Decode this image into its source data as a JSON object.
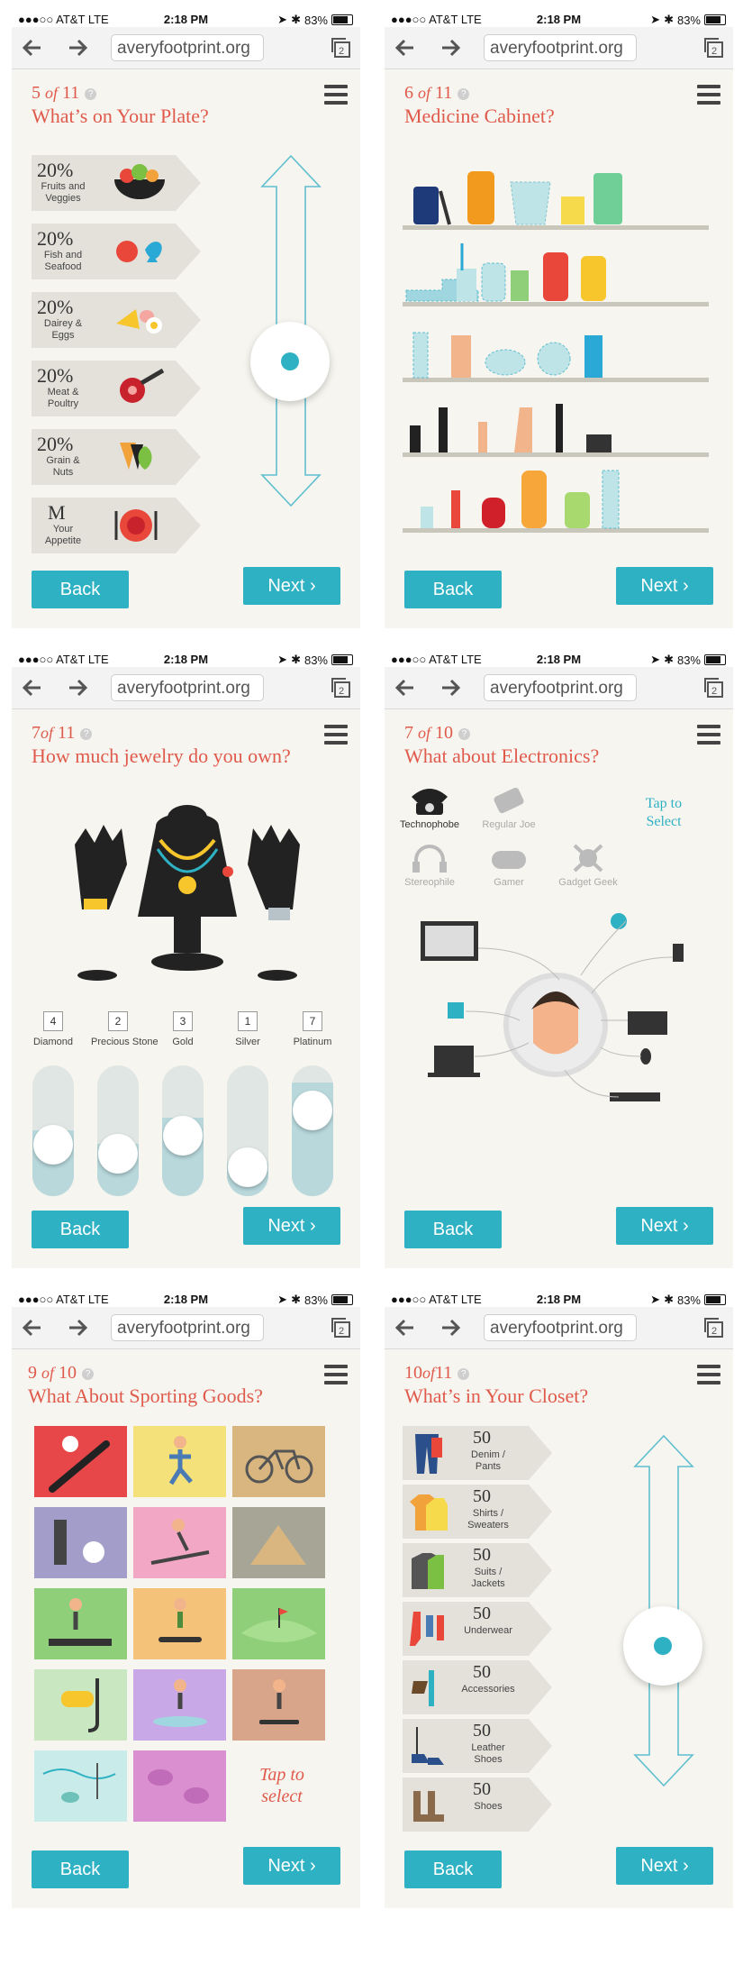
{
  "status": {
    "carrier": "●●●○○ AT&T",
    "network": "LTE",
    "time": "2:18 PM",
    "battery": "83%"
  },
  "url": "averyfootprint.org",
  "buttons": {
    "back": "Back",
    "next": "Next"
  },
  "help": "?",
  "screens": {
    "plate": {
      "step_num": "5",
      "step_of": "of",
      "step_total": "11",
      "question": "What’s on Your Plate?",
      "items": [
        {
          "value": "20%",
          "label": "Fruits and Veggies"
        },
        {
          "value": "20%",
          "label": "Fish and Seafood"
        },
        {
          "value": "20%",
          "label": "Dairey & Eggs"
        },
        {
          "value": "20%",
          "label": "Meat & Poultry"
        },
        {
          "value": "20%",
          "label": "Grain & Nuts"
        },
        {
          "value": "M",
          "label": "Your Appetite"
        }
      ]
    },
    "medicine": {
      "step_num": "6",
      "step_of": "of",
      "step_total": "11",
      "question": "Medicine Cabinet?"
    },
    "jewelry": {
      "step_num": "7",
      "step_of": "of",
      "step_total": "11",
      "question": "How much jewelry do you own?",
      "sliders": [
        {
          "value": "4",
          "label": "Diamond",
          "level": 0.35
        },
        {
          "value": "2",
          "label": "Precious Stone",
          "level": 0.25
        },
        {
          "value": "3",
          "label": "Gold",
          "level": 0.45
        },
        {
          "value": "1",
          "label": "Silver",
          "level": 0.1
        },
        {
          "value": "7",
          "label": "Platinum",
          "level": 0.72
        }
      ]
    },
    "electronics": {
      "step_num": "7",
      "step_of": "of",
      "step_total": "10",
      "question": "What about Electronics?",
      "types": [
        "Technophobe",
        "Regular Joe",
        "Stereophile",
        "Gamer",
        "Gadget Geek"
      ],
      "tap_hint": "Tap to Select"
    },
    "sporting": {
      "step_num": "9",
      "step_of": "of",
      "step_total": "10",
      "question": "What About Sporting Goods?",
      "tap_hint": "Tap to select"
    },
    "closet": {
      "step_num": "10",
      "step_of": "of",
      "step_total": "11",
      "question": "What’s in Your Closet?",
      "items": [
        {
          "value": "50",
          "label": "Denim / Pants"
        },
        {
          "value": "50",
          "label": "Shirts / Sweaters"
        },
        {
          "value": "50",
          "label": "Suits / Jackets"
        },
        {
          "value": "50",
          "label": "Underwear"
        },
        {
          "value": "50",
          "label": "Accessories"
        },
        {
          "value": "50",
          "label": "Leather Shoes"
        },
        {
          "value": "50",
          "label": "Shoes"
        }
      ]
    }
  },
  "colors": {
    "accent": "#2fb1c4",
    "title": "#e05a4c",
    "background": "#f6f5ef"
  }
}
